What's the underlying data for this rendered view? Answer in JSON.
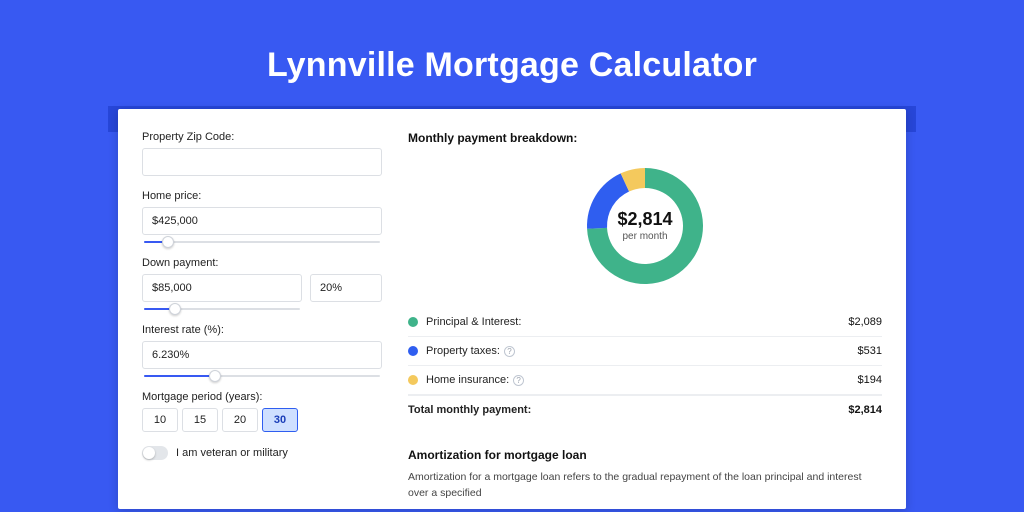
{
  "title": "Lynnville Mortgage Calculator",
  "form": {
    "zip_label": "Property Zip Code:",
    "zip_value": "",
    "home_price_label": "Home price:",
    "home_price_value": "$425,000",
    "home_price_slider_pct": 10,
    "down_label": "Down payment:",
    "down_value": "$85,000",
    "down_pct_value": "20%",
    "down_slider_pct": 20,
    "rate_label": "Interest rate (%):",
    "rate_value": "6.230%",
    "rate_slider_pct": 30,
    "period_label": "Mortgage period (years):",
    "periods": [
      "10",
      "15",
      "20",
      "30"
    ],
    "period_active_index": 3,
    "vet_label": "I am veteran or military"
  },
  "breakdown": {
    "heading": "Monthly payment breakdown:",
    "amount": "$2,814",
    "amount_sub": "per month",
    "rows": [
      {
        "label": "Principal & Interest:",
        "value_text": "$2,089",
        "value_num": 2089,
        "color": "#3fb38a",
        "help": false
      },
      {
        "label": "Property taxes:",
        "value_text": "$531",
        "value_num": 531,
        "color": "#2f5ef0",
        "help": true
      },
      {
        "label": "Home insurance:",
        "value_text": "$194",
        "value_num": 194,
        "color": "#f4c95d",
        "help": true
      }
    ],
    "total_label": "Total monthly payment:",
    "total_value_text": "$2,814",
    "total_value_num": 2814
  },
  "amortization": {
    "heading": "Amortization for mortgage loan",
    "body": "Amortization for a mortgage loan refers to the gradual repayment of the loan principal and interest over a specified"
  },
  "chart_data": {
    "type": "pie",
    "title": "Monthly payment breakdown",
    "series": [
      {
        "name": "Principal & Interest",
        "value": 2089,
        "color": "#3fb38a"
      },
      {
        "name": "Property taxes",
        "value": 531,
        "color": "#2f5ef0"
      },
      {
        "name": "Home insurance",
        "value": 194,
        "color": "#f4c95d"
      }
    ],
    "center_label": "$2,814",
    "center_sublabel": "per month",
    "donut": true
  }
}
